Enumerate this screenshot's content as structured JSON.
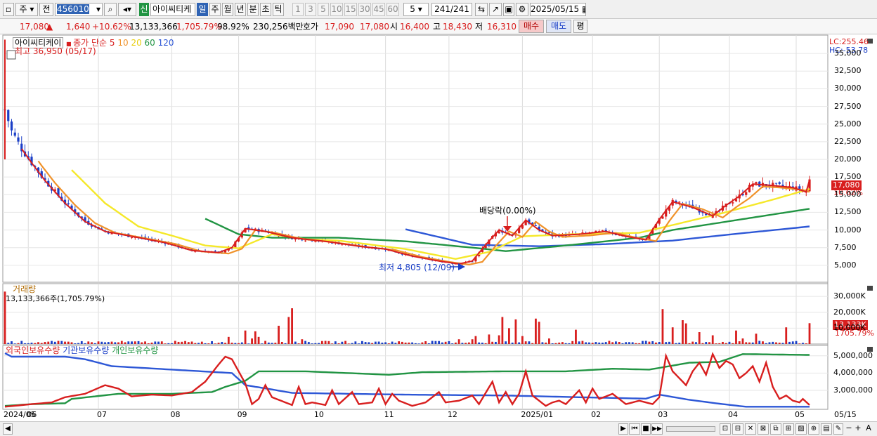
{
  "toolbar": {
    "market": "주",
    "prev": "전",
    "code": "456010",
    "new_badge": "신",
    "stock_name": "아이씨티케",
    "periods": [
      "일",
      "주",
      "월",
      "년",
      "분",
      "초",
      "틱"
    ],
    "active_period": "일",
    "minute_steps": [
      "1",
      "3",
      "5",
      "10",
      "15",
      "30",
      "45",
      "60"
    ],
    "step_value": "5",
    "count": "241",
    "count_total": "/241",
    "date": "2025/05/15"
  },
  "info": {
    "price": "17,080",
    "up_arrow": "▲",
    "change": "1,640",
    "change_pct": "+10.62%",
    "volume": "13,133,366",
    "volume_ratio": "1,705.79%",
    "rate": "98.92%",
    "amount": "230,256백만",
    "quote_label": "호가",
    "ask": "17,090",
    "bid": "17,080",
    "open_label": "시",
    "open": "16,400",
    "high_label": "고",
    "high": "18,430",
    "low_label": "저",
    "low": "16,310",
    "buy": "매수",
    "sell": "매도",
    "eval": "평"
  },
  "chart_data": [
    {
      "type": "line",
      "title": "아이씨티케이",
      "legend": [
        "종가 단순 5",
        "10",
        "20",
        "60",
        "120"
      ],
      "colors": {
        "ma5": "#d81e1e",
        "ma10": "#f0922a",
        "ma20": "#f5e82a",
        "ma60": "#219443",
        "ma120": "#2d57d6",
        "up": "#d81e1e",
        "down": "#1b3fc7"
      },
      "high_note": "최고 36,950 (05/17)",
      "low_note": "최저 4,805 (12/09)",
      "event_note": "배당락(0.00%)",
      "lc": "LC:255.46",
      "hc": "HC:-53.78",
      "ylim": [
        2600,
        37600
      ],
      "yticks": [
        "35,000",
        "32,500",
        "30,000",
        "27,500",
        "25,000",
        "22,500",
        "20,000",
        "17,500",
        "15,000",
        "12,500",
        "10,000",
        "7,500",
        "5,000"
      ],
      "ytick_values": [
        35000,
        32500,
        30000,
        27500,
        25000,
        22500,
        20000,
        17500,
        15000,
        12500,
        10000,
        7500,
        5000
      ],
      "x_labels": [
        "2024/05",
        "06",
        "07",
        "08",
        "09",
        "10",
        "11",
        "12",
        "2025/01",
        "02",
        "03",
        "04",
        "05",
        "05/15"
      ],
      "x_days": [
        0,
        7,
        28,
        50,
        70,
        93,
        114,
        133,
        155,
        176,
        196,
        217,
        237,
        241
      ],
      "last_price_tag": "17,080",
      "last_pct_tag": "10.62%",
      "close_knots": [
        [
          0,
          27000
        ],
        [
          2,
          24000
        ],
        [
          5,
          21500
        ],
        [
          8,
          19500
        ],
        [
          12,
          17000
        ],
        [
          18,
          13800
        ],
        [
          24,
          11200
        ],
        [
          30,
          9800
        ],
        [
          38,
          9100
        ],
        [
          48,
          8200
        ],
        [
          56,
          7100
        ],
        [
          64,
          6800
        ],
        [
          68,
          7500
        ],
        [
          72,
          10200
        ],
        [
          78,
          9800
        ],
        [
          86,
          8900
        ],
        [
          96,
          8400
        ],
        [
          106,
          7700
        ],
        [
          114,
          7300
        ],
        [
          122,
          6300
        ],
        [
          130,
          5600
        ],
        [
          136,
          5200
        ],
        [
          140,
          5600
        ],
        [
          144,
          7900
        ],
        [
          148,
          10000
        ],
        [
          152,
          9200
        ],
        [
          156,
          11400
        ],
        [
          160,
          10000
        ],
        [
          164,
          9200
        ],
        [
          172,
          9400
        ],
        [
          180,
          9800
        ],
        [
          186,
          9100
        ],
        [
          192,
          8600
        ],
        [
          196,
          11500
        ],
        [
          200,
          14000
        ],
        [
          206,
          13200
        ],
        [
          212,
          12000
        ],
        [
          216,
          13500
        ],
        [
          220,
          14800
        ],
        [
          224,
          16500
        ],
        [
          230,
          16300
        ],
        [
          236,
          16000
        ],
        [
          240,
          15400
        ],
        [
          241,
          17080
        ]
      ],
      "ma20_knots": [
        [
          20,
          18500
        ],
        [
          30,
          13800
        ],
        [
          40,
          10500
        ],
        [
          50,
          9200
        ],
        [
          60,
          7800
        ],
        [
          70,
          7400
        ],
        [
          80,
          9400
        ],
        [
          90,
          8700
        ],
        [
          100,
          8500
        ],
        [
          120,
          7300
        ],
        [
          135,
          5900
        ],
        [
          145,
          6900
        ],
        [
          155,
          9100
        ],
        [
          170,
          9400
        ],
        [
          190,
          9600
        ],
        [
          200,
          10700
        ],
        [
          215,
          12400
        ],
        [
          230,
          14300
        ],
        [
          241,
          15800
        ]
      ],
      "ma60_knots": [
        [
          60,
          11600
        ],
        [
          70,
          9400
        ],
        [
          80,
          8900
        ],
        [
          100,
          8900
        ],
        [
          120,
          8400
        ],
        [
          140,
          7500
        ],
        [
          150,
          7000
        ],
        [
          170,
          7900
        ],
        [
          190,
          8900
        ],
        [
          200,
          10000
        ],
        [
          215,
          11100
        ],
        [
          230,
          12200
        ],
        [
          241,
          13000
        ]
      ],
      "ma120_knots": [
        [
          120,
          10100
        ],
        [
          140,
          7900
        ],
        [
          160,
          7700
        ],
        [
          180,
          8000
        ],
        [
          200,
          8500
        ],
        [
          220,
          9500
        ],
        [
          241,
          10500
        ]
      ]
    },
    {
      "type": "bar",
      "title": "거래량",
      "note": "13,133,366주(1,705.79%)",
      "yticks": [
        "30,000K",
        "20,000K",
        "10,000K"
      ],
      "ytick_values": [
        30000,
        20000,
        10000
      ],
      "ylim": [
        0,
        38000
      ],
      "last_tag": "13,133K",
      "last_pct": "1705.79%",
      "spikes": [
        [
          0,
          33000
        ],
        [
          67,
          4500
        ],
        [
          72,
          8500
        ],
        [
          74,
          3500
        ],
        [
          75,
          8000
        ],
        [
          76,
          4500
        ],
        [
          82,
          11500
        ],
        [
          85,
          17000
        ],
        [
          86,
          22500
        ],
        [
          89,
          3000
        ],
        [
          136,
          3000
        ],
        [
          140,
          3000
        ],
        [
          141,
          5000
        ],
        [
          145,
          6000
        ],
        [
          148,
          5500
        ],
        [
          149,
          17000
        ],
        [
          151,
          10000
        ],
        [
          153,
          15500
        ],
        [
          155,
          5000
        ],
        [
          159,
          16000
        ],
        [
          160,
          14000
        ],
        [
          163,
          3500
        ],
        [
          171,
          9000
        ],
        [
          197,
          22000
        ],
        [
          200,
          10500
        ],
        [
          203,
          15000
        ],
        [
          204,
          13000
        ],
        [
          208,
          7500
        ],
        [
          212,
          5500
        ],
        [
          219,
          8500
        ],
        [
          221,
          3500
        ],
        [
          225,
          6500
        ],
        [
          234,
          10500
        ],
        [
          241,
          13133
        ]
      ]
    },
    {
      "type": "line",
      "title": "외국인보유수량 · 기관보유수량 · 개인보유수량",
      "series_names": [
        "외국인보유수량",
        "기관보유수량",
        "개인보유수량"
      ],
      "yticks": [
        "5,000,000",
        "4,000,000",
        "3,000,000"
      ],
      "ytick_values": [
        5000000,
        4000000,
        3000000
      ],
      "ylim": [
        1900000,
        5600000
      ],
      "blue_knots": [
        [
          0,
          5150000
        ],
        [
          2,
          4950000
        ],
        [
          18,
          4950000
        ],
        [
          24,
          4800000
        ],
        [
          32,
          4400000
        ],
        [
          68,
          4000000
        ],
        [
          72,
          3300000
        ],
        [
          80,
          3050000
        ],
        [
          86,
          2850000
        ],
        [
          120,
          2750000
        ],
        [
          150,
          2700000
        ],
        [
          172,
          2600000
        ],
        [
          192,
          2520000
        ],
        [
          196,
          2750000
        ],
        [
          205,
          2450000
        ],
        [
          215,
          2200000
        ],
        [
          222,
          2050000
        ],
        [
          241,
          2050000
        ]
      ],
      "green_knots": [
        [
          0,
          2100000
        ],
        [
          8,
          2200000
        ],
        [
          18,
          2250000
        ],
        [
          20,
          2500000
        ],
        [
          34,
          2800000
        ],
        [
          50,
          2800000
        ],
        [
          62,
          2900000
        ],
        [
          66,
          3200000
        ],
        [
          72,
          3550000
        ],
        [
          76,
          4100000
        ],
        [
          90,
          4100000
        ],
        [
          115,
          3900000
        ],
        [
          125,
          4050000
        ],
        [
          150,
          4100000
        ],
        [
          168,
          4100000
        ],
        [
          182,
          4250000
        ],
        [
          193,
          4200000
        ],
        [
          205,
          4600000
        ],
        [
          214,
          4650000
        ],
        [
          221,
          5100000
        ],
        [
          241,
          5050000
        ]
      ],
      "red_knots": [
        [
          0,
          2050000
        ],
        [
          8,
          2200000
        ],
        [
          14,
          2300000
        ],
        [
          18,
          2600000
        ],
        [
          24,
          2800000
        ],
        [
          30,
          3300000
        ],
        [
          34,
          3100000
        ],
        [
          38,
          2650000
        ],
        [
          44,
          2750000
        ],
        [
          50,
          2700000
        ],
        [
          56,
          2900000
        ],
        [
          60,
          3500000
        ],
        [
          64,
          4500000
        ],
        [
          66,
          4950000
        ],
        [
          68,
          4800000
        ],
        [
          70,
          4100000
        ],
        [
          72,
          3400000
        ],
        [
          74,
          2200000
        ],
        [
          76,
          2500000
        ],
        [
          78,
          3300000
        ],
        [
          80,
          2600000
        ],
        [
          84,
          2300000
        ],
        [
          86,
          2150000
        ],
        [
          88,
          3200000
        ],
        [
          90,
          2200000
        ],
        [
          92,
          2300000
        ],
        [
          96,
          2150000
        ],
        [
          98,
          3000000
        ],
        [
          100,
          2200000
        ],
        [
          104,
          2900000
        ],
        [
          106,
          2200000
        ],
        [
          110,
          2300000
        ],
        [
          112,
          3100000
        ],
        [
          114,
          2200000
        ],
        [
          116,
          2800000
        ],
        [
          118,
          2400000
        ],
        [
          122,
          2100000
        ],
        [
          126,
          2300000
        ],
        [
          130,
          2900000
        ],
        [
          132,
          2300000
        ],
        [
          136,
          2400000
        ],
        [
          140,
          2700000
        ],
        [
          142,
          2200000
        ],
        [
          146,
          3500000
        ],
        [
          148,
          2300000
        ],
        [
          150,
          2900000
        ],
        [
          152,
          2200000
        ],
        [
          154,
          2800000
        ],
        [
          156,
          4100000
        ],
        [
          158,
          2700000
        ],
        [
          160,
          2400000
        ],
        [
          162,
          2100000
        ],
        [
          164,
          2300000
        ],
        [
          166,
          2400000
        ],
        [
          168,
          2200000
        ],
        [
          172,
          3000000
        ],
        [
          174,
          2300000
        ],
        [
          176,
          3100000
        ],
        [
          178,
          2500000
        ],
        [
          182,
          2800000
        ],
        [
          186,
          2200000
        ],
        [
          190,
          2400000
        ],
        [
          194,
          2200000
        ],
        [
          196,
          2600000
        ],
        [
          198,
          5000000
        ],
        [
          200,
          4100000
        ],
        [
          204,
          3300000
        ],
        [
          206,
          4100000
        ],
        [
          208,
          4600000
        ],
        [
          210,
          3900000
        ],
        [
          212,
          5100000
        ],
        [
          214,
          4300000
        ],
        [
          216,
          4700000
        ],
        [
          218,
          4500000
        ],
        [
          220,
          3700000
        ],
        [
          222,
          4000000
        ],
        [
          224,
          4400000
        ],
        [
          226,
          3500000
        ],
        [
          228,
          4600000
        ],
        [
          230,
          3200000
        ],
        [
          232,
          2500000
        ],
        [
          234,
          2700000
        ],
        [
          236,
          2400000
        ],
        [
          238,
          2300000
        ],
        [
          239,
          2500000
        ],
        [
          241,
          2150000
        ]
      ]
    }
  ],
  "bottom": {
    "buttons": [
      "▶",
      "⏮",
      "■",
      "▶▶",
      "⏭"
    ]
  }
}
